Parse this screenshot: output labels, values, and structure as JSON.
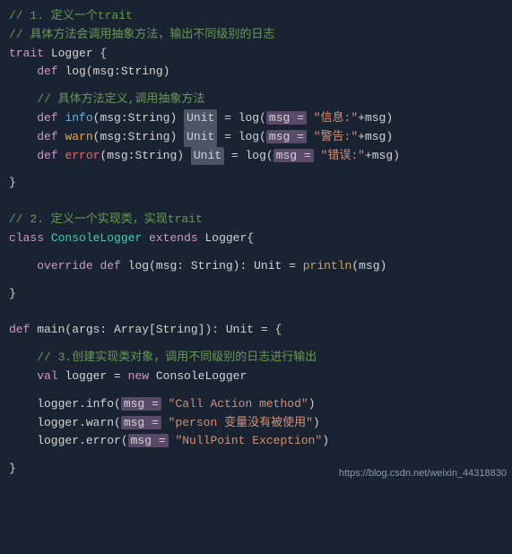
{
  "code": {
    "lines": [
      {
        "type": "comment",
        "text": "// 1. 定义一个trait"
      },
      {
        "type": "comment",
        "text": "// 具体方法会调用抽象方法，输出不同级别的日志"
      },
      {
        "type": "code",
        "text": "trait Logger {"
      },
      {
        "type": "code_indent",
        "text": "    def log(msg:String)"
      },
      {
        "type": "blank"
      },
      {
        "type": "comment_indent",
        "text": "    // 具体方法定义,调用抽象方法"
      },
      {
        "type": "info_line"
      },
      {
        "type": "warn_line"
      },
      {
        "type": "error_line"
      },
      {
        "type": "blank"
      },
      {
        "type": "code",
        "text": "}"
      },
      {
        "type": "blank"
      },
      {
        "type": "blank"
      },
      {
        "type": "comment",
        "text": "// 2. 定义一个实现类，实现trait"
      },
      {
        "type": "class_line"
      },
      {
        "type": "blank"
      },
      {
        "type": "override_line"
      },
      {
        "type": "blank"
      },
      {
        "type": "close_brace",
        "text": "}"
      },
      {
        "type": "blank"
      },
      {
        "type": "blank"
      },
      {
        "type": "main_line"
      },
      {
        "type": "blank"
      },
      {
        "type": "comment_indent",
        "text": "    // 3.创建实现类对象，调用不同级别的日志进行输出"
      },
      {
        "type": "val_line"
      },
      {
        "type": "blank"
      },
      {
        "type": "logger_info_line"
      },
      {
        "type": "logger_warn_line"
      },
      {
        "type": "logger_error_line"
      },
      {
        "type": "blank"
      },
      {
        "type": "code",
        "text": "}"
      }
    ],
    "watermark": "https://blog.csdn.net/weixin_44318830"
  }
}
